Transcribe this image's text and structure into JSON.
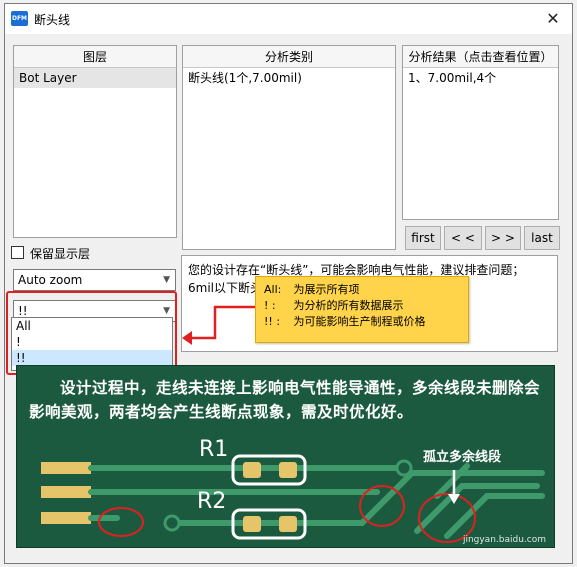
{
  "window": {
    "title": "断头线",
    "app_icon_text": "DFM",
    "close_glyph": "✕"
  },
  "layers_panel": {
    "header": "图层",
    "items": [
      "Bot Layer"
    ]
  },
  "category_panel": {
    "header": "分析类别",
    "items": [
      "断头线(1个,7.00mil)"
    ]
  },
  "results_panel": {
    "header": "分析结果（点击查看位置）",
    "items": [
      "1、7.00mil,4个"
    ]
  },
  "nav_buttons": {
    "first": "first",
    "prev": "< <",
    "next": "> >",
    "last": "last"
  },
  "keep_layer_checkbox": {
    "label": "保留显示层",
    "checked": false
  },
  "zoom_combo": {
    "value": "Auto zoom"
  },
  "filter_combo": {
    "value": "!!",
    "options": [
      "All",
      "!",
      "!!"
    ],
    "selected_index": 2
  },
  "description": {
    "line1": "您的设计存在“断头线”，可能会影响电气性能，建议排查问题；",
    "line2": "6mil以下断头线"
  },
  "callout": {
    "rows": [
      {
        "key": "All:",
        "text": "为展示所有项"
      },
      {
        "key": "!  :",
        "text": "为分析的所有数据展示"
      },
      {
        "key": "!! :",
        "text": "为可能影响生产制程或价格"
      }
    ]
  },
  "pcb_image": {
    "caption": "设计过程中，走线未连接上影响电气性能导通性，多余线段未删除会影响美观，两者均会产生线断点现象，需及时优化好。",
    "label_r1": "R1",
    "label_r2": "R2",
    "label_isolated": "孤立多余线段",
    "watermark": "jingyan.baidu.com"
  },
  "colors": {
    "pcb_board": "#1c5a40",
    "copper_pad": "#e6c46a",
    "highlight_red": "#e02020",
    "callout_yellow": "#ffd34a",
    "selection_blue": "#cce8ff"
  }
}
